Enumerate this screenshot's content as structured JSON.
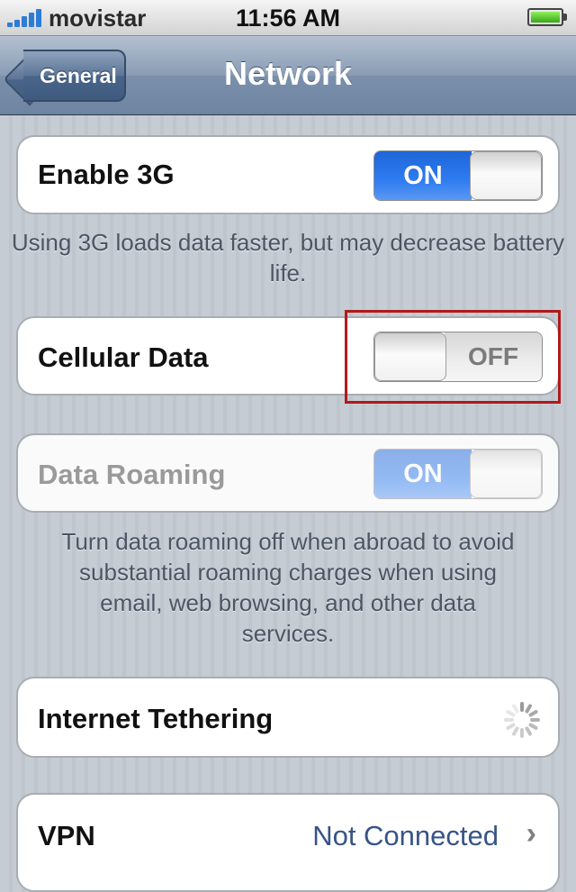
{
  "status_bar": {
    "carrier": "movistar",
    "time": "11:56 AM",
    "signal_icon": "signal-bars-icon",
    "battery_icon": "battery-icon"
  },
  "nav": {
    "back_label": "General",
    "title": "Network"
  },
  "settings": {
    "enable_3g": {
      "label": "Enable 3G",
      "state": "ON"
    },
    "enable_3g_note": "Using 3G loads data faster, but may decrease battery life.",
    "cellular_data": {
      "label": "Cellular Data",
      "state": "OFF"
    },
    "data_roaming": {
      "label": "Data Roaming",
      "state": "ON"
    },
    "roaming_note": "Turn data roaming off when abroad to avoid substantial roaming charges when using email, web browsing, and other data services.",
    "internet_tethering": {
      "label": "Internet Tethering"
    },
    "vpn": {
      "label": "VPN",
      "value": "Not Connected"
    }
  },
  "colors": {
    "switch_on": "#2f7cf0",
    "highlight": "#b11a1a",
    "value_text": "#385487"
  }
}
